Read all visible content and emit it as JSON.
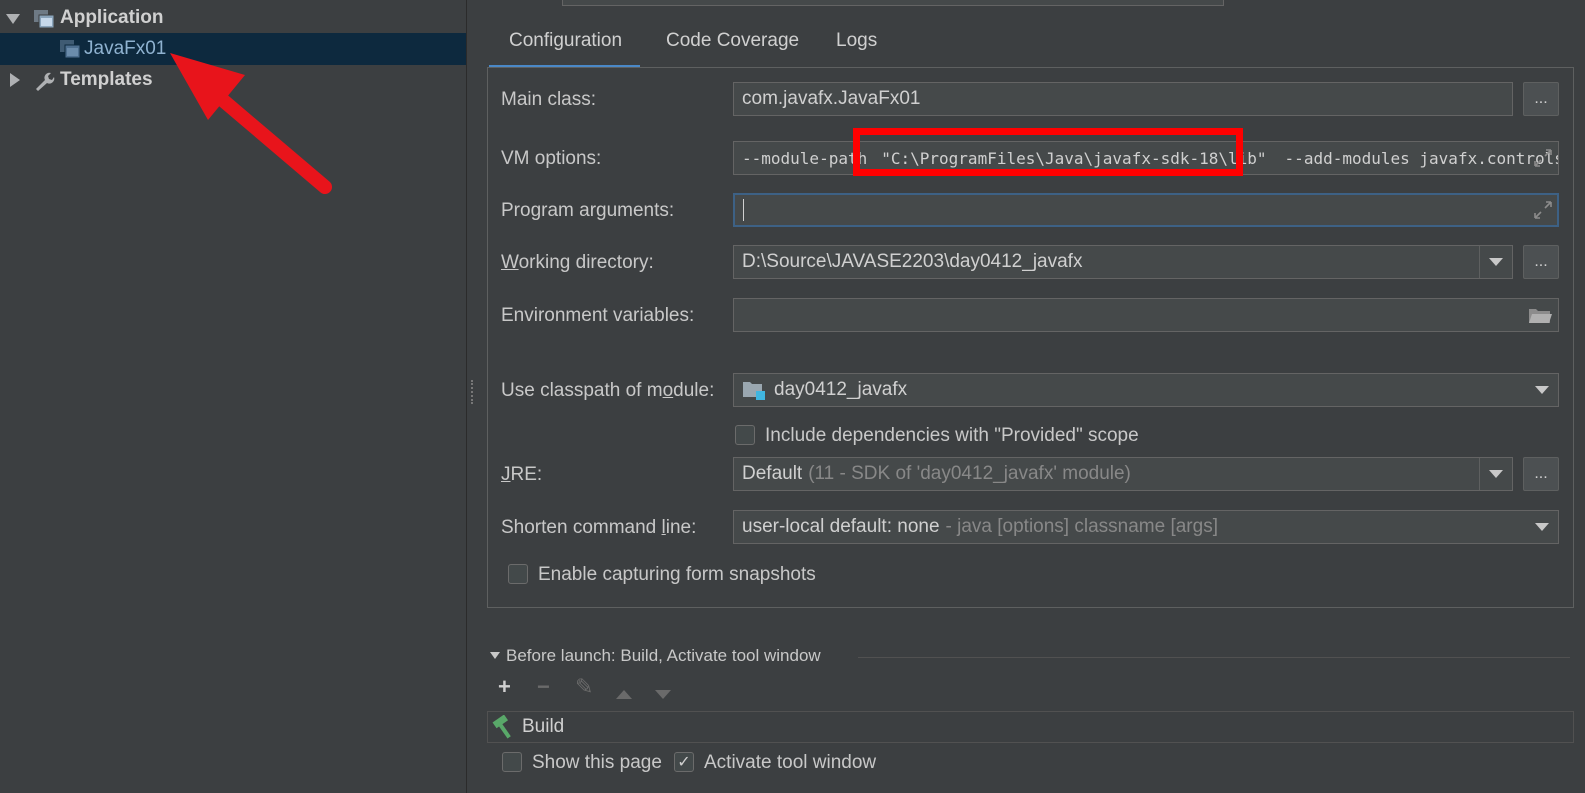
{
  "tree": {
    "application_label": "Application",
    "config_item_label": "JavaFx01",
    "templates_label": "Templates"
  },
  "tabs": [
    {
      "label": "Configuration",
      "active": true
    },
    {
      "label": "Code Coverage",
      "active": false
    },
    {
      "label": "Logs",
      "active": false
    }
  ],
  "form": {
    "main_class": {
      "label": "Main class:",
      "value": "com.javafx.JavaFx01",
      "browse": "..."
    },
    "vm_options": {
      "label": "VM options:",
      "value_prefix": "--module-path",
      "highlighted": "\"C:\\ProgramFiles\\Java\\javafx-sdk-18\\lib\"",
      "value_suffix": "--add-modules javafx.controls,ja"
    },
    "program_arguments": {
      "label": "Program arguments:",
      "value": ""
    },
    "working_directory": {
      "label": "Working directory:",
      "value": "D:\\Source\\JAVASE2203\\day0412_javafx",
      "browse": "..."
    },
    "environment_variables": {
      "label": "Environment variables:",
      "value": ""
    },
    "classpath_module": {
      "label": "Use classpath of module:",
      "value": "day0412_javafx"
    },
    "include_provided": {
      "label": "Include dependencies with \"Provided\" scope",
      "checked": false
    },
    "jre": {
      "label": "JRE:",
      "value": "Default",
      "detail": "(11 - SDK of 'day0412_javafx' module)",
      "browse": "..."
    },
    "shorten_cmd": {
      "label": "Shorten command line:",
      "value": "user-local default: none",
      "detail": "- java [options] classname [args]"
    },
    "enable_snapshots": {
      "label": "Enable capturing form snapshots",
      "checked": false
    }
  },
  "before_launch": {
    "title": "Before launch: Build, Activate tool window",
    "task_label": "Build",
    "show_page": {
      "label": "Show this page",
      "checked": false
    },
    "activate_tool": {
      "label": "Activate tool window",
      "checked": true
    }
  },
  "colors": {
    "highlight_box": "#ff0000",
    "arrow": "#e8141b",
    "tab_underline": "#4a88c7",
    "selection": "#0d293e"
  }
}
